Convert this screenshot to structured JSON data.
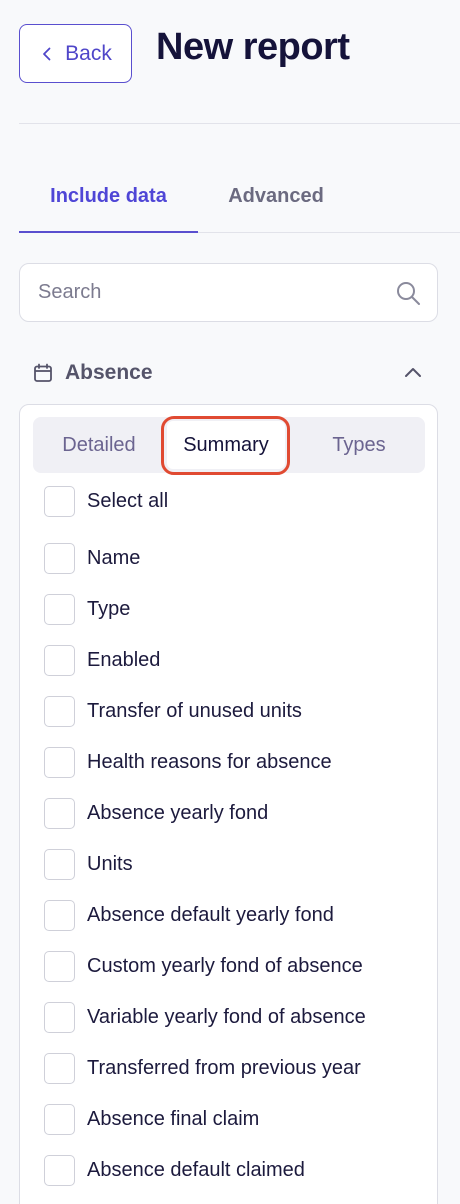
{
  "header": {
    "back_label": "Back",
    "title": "New report"
  },
  "tabs": [
    {
      "label": "Include data",
      "active": true
    },
    {
      "label": "Advanced",
      "active": false
    }
  ],
  "search": {
    "placeholder": "Search",
    "value": ""
  },
  "section": {
    "title": "Absence",
    "icon": "calendar-icon",
    "expanded": true,
    "view_options": [
      "Detailed",
      "Summary",
      "Types"
    ],
    "selected_view": "Summary",
    "select_all_label": "Select all",
    "fields": [
      {
        "label": "Name",
        "checked": false
      },
      {
        "label": "Type",
        "checked": false
      },
      {
        "label": "Enabled",
        "checked": false
      },
      {
        "label": "Transfer of unused units",
        "checked": false
      },
      {
        "label": "Health reasons for absence",
        "checked": false
      },
      {
        "label": "Absence yearly fond",
        "checked": false
      },
      {
        "label": "Units",
        "checked": false
      },
      {
        "label": "Absence default yearly fond",
        "checked": false
      },
      {
        "label": "Custom yearly fond of absence",
        "checked": false
      },
      {
        "label": "Variable yearly fond of absence",
        "checked": false
      },
      {
        "label": "Transferred from previous year",
        "checked": false
      },
      {
        "label": "Absence final claim",
        "checked": false
      },
      {
        "label": "Absence default claimed",
        "checked": false
      }
    ]
  },
  "colors": {
    "accent": "#5a4fcf",
    "highlight": "#e04a32",
    "background": "#f8f9fb"
  }
}
